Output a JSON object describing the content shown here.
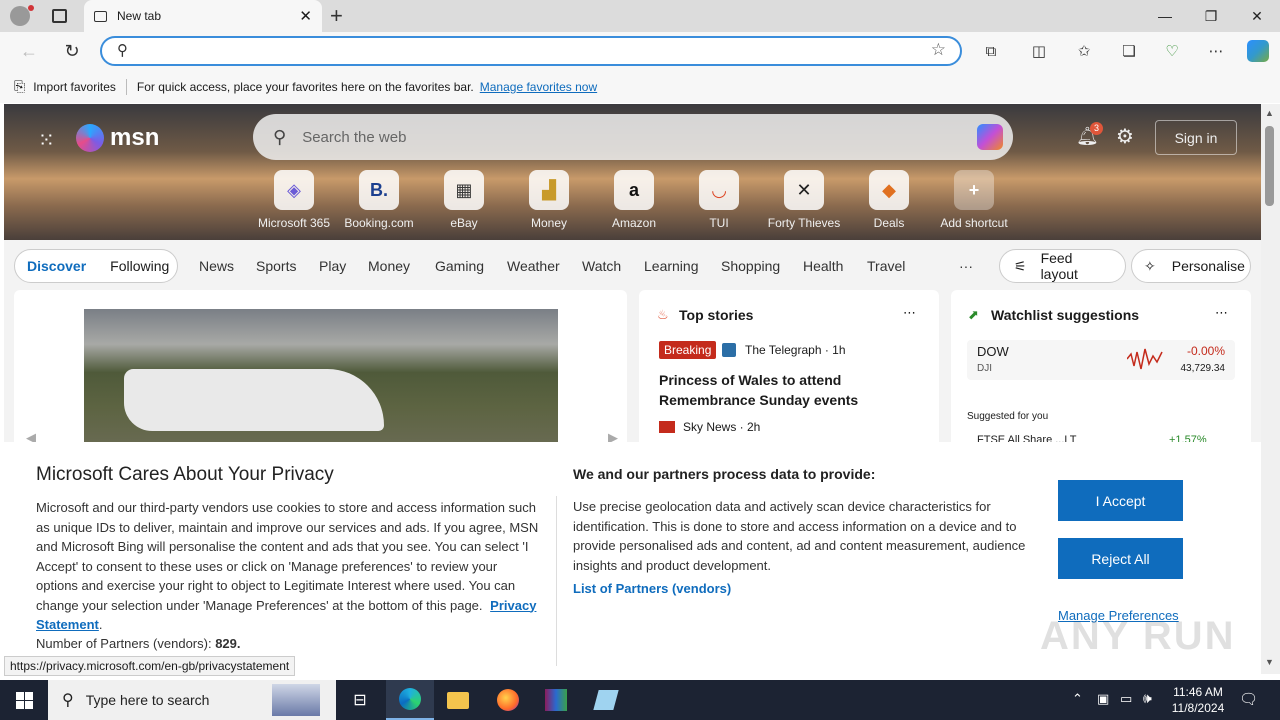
{
  "browser": {
    "tab_title": "New tab",
    "address_placeholder": "",
    "favbar": {
      "import_label": "Import favorites",
      "hint": "For quick access, place your favorites here on the favorites bar.",
      "manage_link": "Manage favorites now"
    }
  },
  "msn": {
    "logo_text": "msn",
    "search_placeholder": "Search the web",
    "notification_count": "3",
    "sign_in": "Sign in",
    "shortcuts": [
      {
        "label": "Microsoft 365",
        "icon": "m365-icon",
        "glyph": "◈",
        "color": "#6b5bd6"
      },
      {
        "label": "Booking.com",
        "icon": "booking-icon",
        "glyph": "B.",
        "color": "#1b3f8f"
      },
      {
        "label": "eBay",
        "icon": "ebay-icon",
        "glyph": "▦",
        "color": "#3a3a3a"
      },
      {
        "label": "Money",
        "icon": "money-icon",
        "glyph": "▟",
        "color": "#c89a2a"
      },
      {
        "label": "Amazon",
        "icon": "amazon-icon",
        "glyph": "a",
        "color": "#111"
      },
      {
        "label": "TUI",
        "icon": "tui-icon",
        "glyph": "◡",
        "color": "#d42"
      },
      {
        "label": "Forty Thieves",
        "icon": "forty-thieves-icon",
        "glyph": "✕",
        "color": "#222"
      },
      {
        "label": "Deals",
        "icon": "deals-icon",
        "glyph": "◆",
        "color": "#e07020"
      },
      {
        "label": "Add shortcut",
        "icon": "add-icon",
        "glyph": "+",
        "color": "#555"
      }
    ],
    "tabs": [
      "Discover",
      "Following"
    ],
    "nav": [
      "News",
      "Sports",
      "Play",
      "Money",
      "Gaming",
      "Weather",
      "Watch",
      "Learning",
      "Shopping",
      "Health",
      "Travel"
    ],
    "more_label": "···",
    "feed_layout": "Feed layout",
    "personalise": "Personalise",
    "top_stories": {
      "title": "Top stories",
      "badge": "Breaking",
      "source1": "The Telegraph · 1h",
      "headline1": "Princess of Wales to attend Remembrance Sunday events",
      "source2": "Sky News · 2h"
    },
    "watchlist": {
      "title": "Watchlist suggestions",
      "symbol": "DOW",
      "sub": "DJI",
      "change": "-0.00%",
      "price": "43,729.34",
      "suggested": "Suggested for you",
      "next_symbol": "FTSE All Share ...LT",
      "next_change": "+1.57%"
    }
  },
  "privacy": {
    "title": "Microsoft Cares About Your Privacy",
    "body": "Microsoft and our third-party vendors use cookies to store and access information such as unique IDs to deliver, maintain and improve our services and ads. If you agree, MSN and Microsoft Bing will personalise the content and ads that you see. You can select 'I Accept' to consent to these uses or click on 'Manage preferences' to review your options and exercise your right to object to Legitimate Interest where used.  You can change your selection under 'Manage Preferences' at the bottom of this page.",
    "privacy_link": "Privacy Statement",
    "partners_label": "Number of Partners (vendors):",
    "partners_count": "829.",
    "right_title": "We and our partners process data to provide:",
    "right_body": "Use precise geolocation data and actively scan device characteristics for identification. This is done to store and access information on a device and to provide personalised ads and content, ad and content measurement, audience insights and product development.",
    "partners_link": "List of Partners (vendors)",
    "accept": "I Accept",
    "reject": "Reject All",
    "manage": "Manage Preferences"
  },
  "status_url": "https://privacy.microsoft.com/en-gb/privacystatement",
  "taskbar": {
    "search_placeholder": "Type here to search",
    "time": "11:46 AM",
    "date": "11/8/2024"
  },
  "watermark": "ANY RUN"
}
